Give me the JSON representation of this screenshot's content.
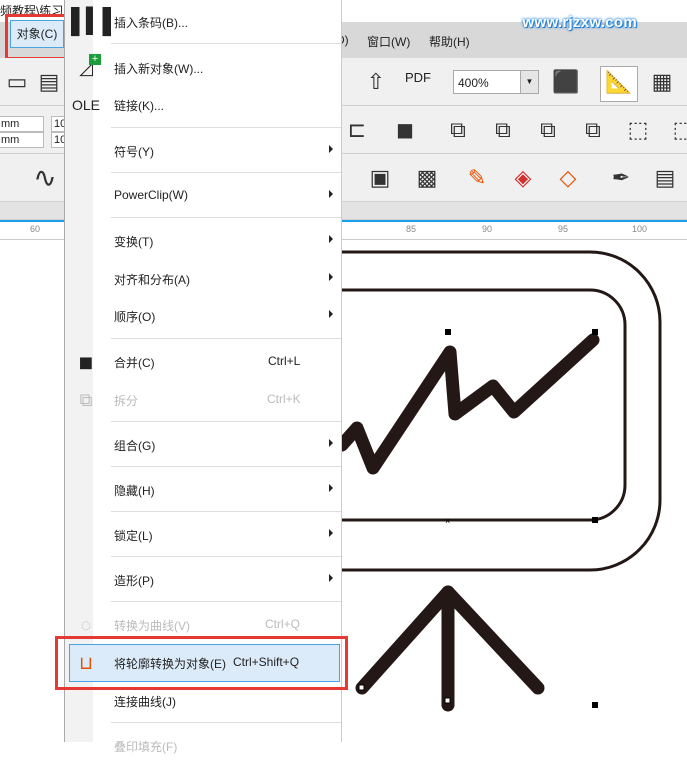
{
  "title_fragment": "频教程\\练习题",
  "watermark": "www.rjzxw.com",
  "menubar": {
    "object": "对象(C)",
    "window": "窗口(W)",
    "help": "帮助(H)",
    "partial": "D)"
  },
  "toolbar": {
    "zoom_value": "400%",
    "pdf_label": "PDF"
  },
  "property_bar": {
    "x_unit": "mm",
    "y_unit": "mm",
    "w_val": "10",
    "h_val": "10"
  },
  "ruler": {
    "ticks": [
      "60",
      "85",
      "90",
      "95",
      "100"
    ]
  },
  "menu": {
    "items": [
      {
        "label": "插入条码(B)...",
        "icon": "barcode-icon"
      },
      {
        "label": "插入新对象(W)...",
        "icon": "insert-object-icon"
      },
      {
        "label": "链接(K)...",
        "icon": "ole-link-icon"
      },
      {
        "label": "符号(Y)",
        "submenu": true
      },
      {
        "label": "PowerClip(W)",
        "submenu": true
      },
      {
        "label": "变换(T)",
        "submenu": true
      },
      {
        "label": "对齐和分布(A)",
        "submenu": true
      },
      {
        "label": "顺序(O)",
        "submenu": true
      },
      {
        "label": "合并(C)",
        "shortcut": "Ctrl+L",
        "icon": "combine-icon"
      },
      {
        "label": "拆分",
        "shortcut": "Ctrl+K",
        "disabled": true,
        "icon": "break-apart-icon"
      },
      {
        "label": "组合(G)",
        "submenu": true
      },
      {
        "label": "隐藏(H)",
        "submenu": true
      },
      {
        "label": "锁定(L)",
        "submenu": true
      },
      {
        "label": "造形(P)",
        "submenu": true
      },
      {
        "label": "转换为曲线(V)",
        "shortcut": "Ctrl+Q",
        "disabled": true,
        "icon": "convert-to-curves-icon"
      },
      {
        "label": "将轮廓转换为对象(E)",
        "shortcut": "Ctrl+Shift+Q",
        "highlighted": true,
        "icon": "outline-to-object-icon"
      },
      {
        "label": "连接曲线(J)"
      },
      {
        "label": "叠印填充(F)",
        "disabled": true
      }
    ]
  },
  "colors": {
    "highlight": "#dcebf9",
    "annotation": "#e53935",
    "accent": "#1aa0e8"
  }
}
